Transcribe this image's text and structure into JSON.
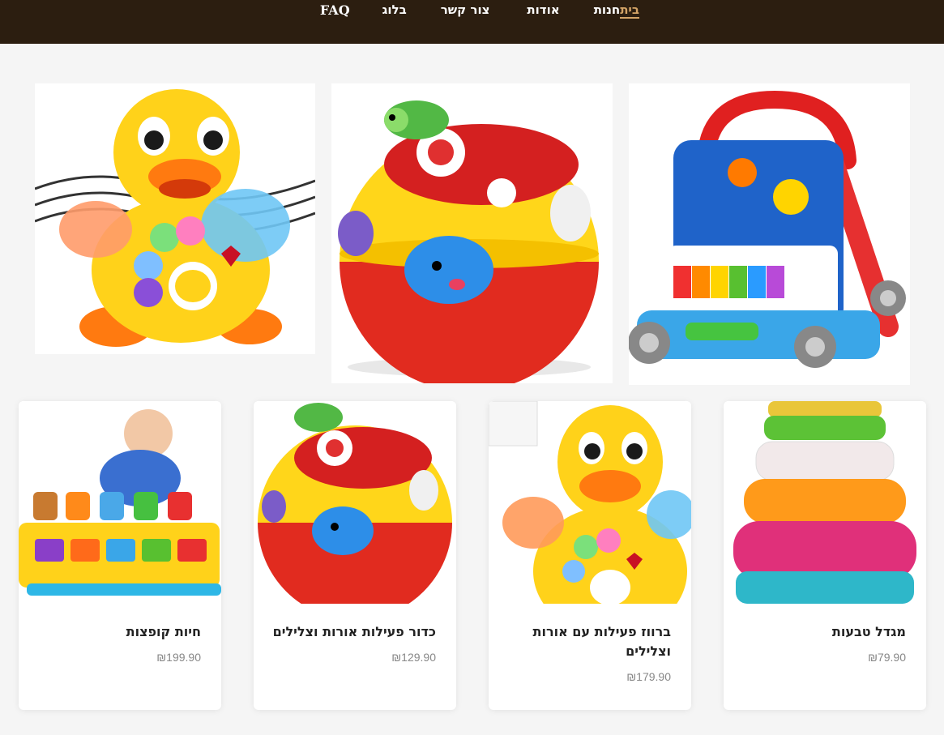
{
  "nav": {
    "items": [
      {
        "label": "בית",
        "active": true
      },
      {
        "label": "חנות"
      },
      {
        "label": "אודות"
      },
      {
        "label": "צור קשר"
      },
      {
        "label": "בלוג"
      },
      {
        "label": "FAQ"
      }
    ]
  },
  "hero_images": [
    {
      "name": "activity-walker-image"
    },
    {
      "name": "activity-ball-image"
    },
    {
      "name": "dancing-duck-image"
    }
  ],
  "products": [
    {
      "title": "מגדל טבעות",
      "price": "₪79.90"
    },
    {
      "title": "ברווז פעילות עם אורות וצלילים",
      "price": "₪179.90"
    },
    {
      "title": "כדור פעילות אורות וצלילים",
      "price": "₪129.90"
    },
    {
      "title": "חיות קופצות",
      "price": "₪199.90"
    }
  ],
  "colors": {
    "header": "#2c1e10",
    "active_nav": "#d4a467",
    "background": "#f5f5f5"
  }
}
